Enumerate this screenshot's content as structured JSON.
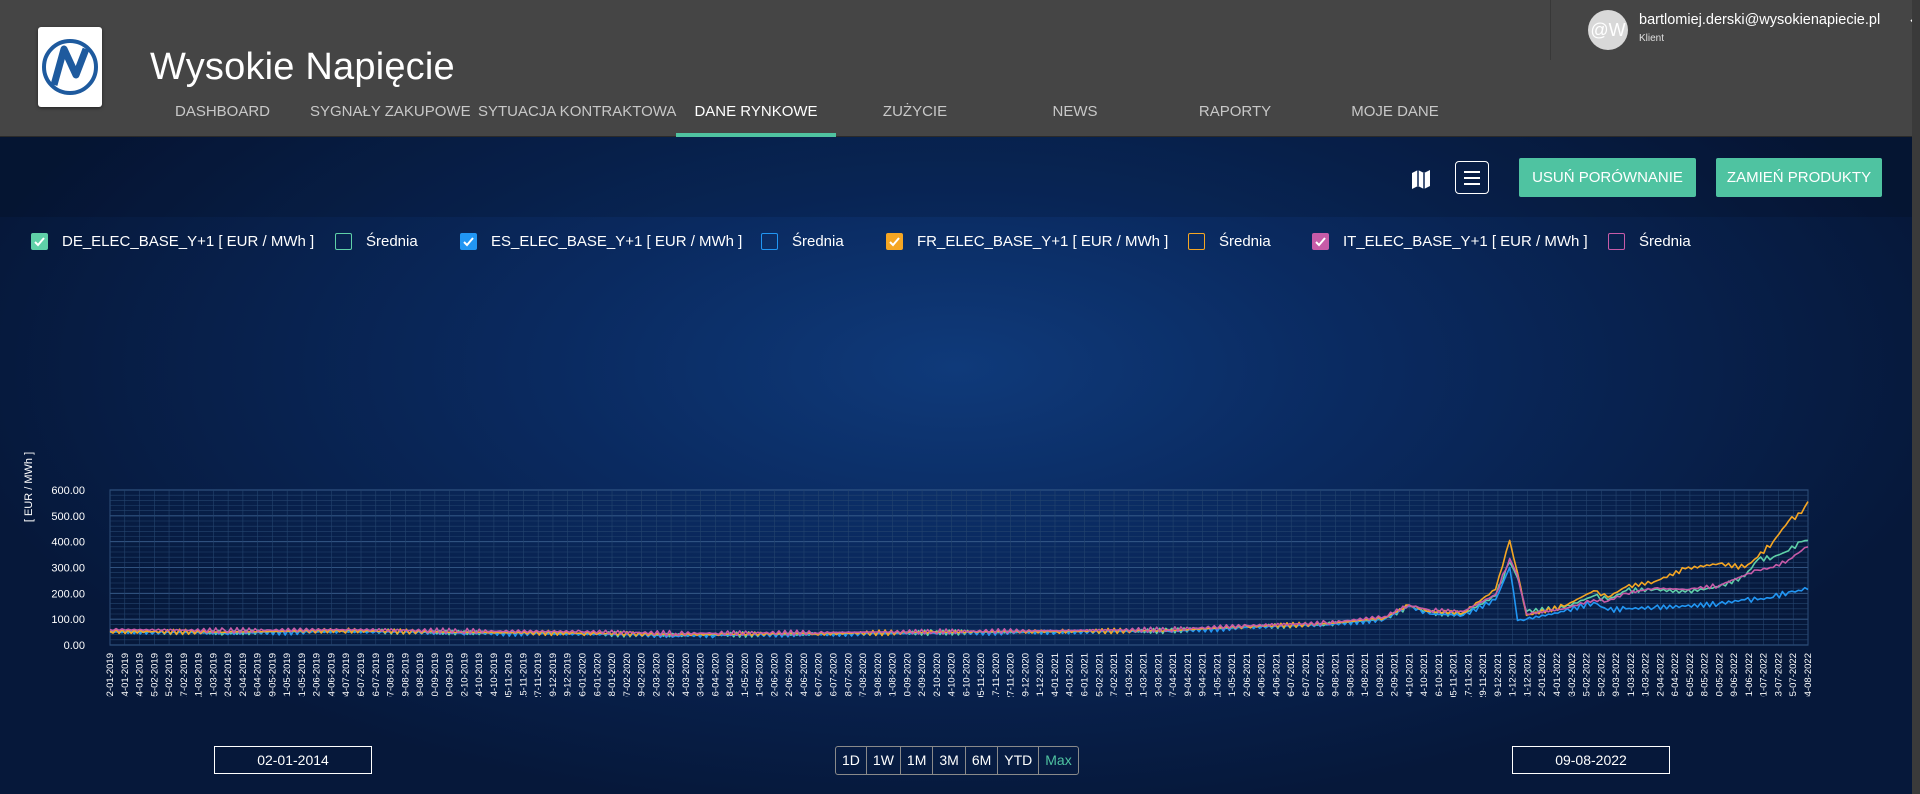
{
  "app": {
    "title": "Wysokie Napięcie"
  },
  "nav": {
    "items": [
      {
        "label": "DASHBOARD",
        "active": false
      },
      {
        "label": "SYGNAŁY ZAKUPOWE",
        "active": false
      },
      {
        "label": "SYTUACJA KONTRAKTOWA",
        "active": false
      },
      {
        "label": "DANE RYNKOWE",
        "active": true
      },
      {
        "label": "ZUŻYCIE",
        "active": false
      },
      {
        "label": "NEWS",
        "active": false
      },
      {
        "label": "RAPORTY",
        "active": false
      },
      {
        "label": "MOJE DANE",
        "active": false
      }
    ]
  },
  "user": {
    "avatar_text": "@W",
    "email": "bartlomiej.derski@wysokienapiecie.pl",
    "role": "Klient"
  },
  "toolbar": {
    "map_icon": "map-icon",
    "menu_icon": "hamburger-menu-icon",
    "remove_compare_label": "USUŃ PORÓWNANIE",
    "swap_products_label": "ZAMIEŃ PRODUKTY"
  },
  "legend": [
    {
      "label": "DE_ELEC_BASE_Y+1 [ EUR / MWh ]",
      "checked": true,
      "color": "#5fd0a8"
    },
    {
      "label": "Średnia",
      "checked": false,
      "color": "#5fd0a8"
    },
    {
      "label": "ES_ELEC_BASE_Y+1 [ EUR / MWh ]",
      "checked": true,
      "color": "#2196f3"
    },
    {
      "label": "Średnia",
      "checked": false,
      "color": "#2196f3"
    },
    {
      "label": "FR_ELEC_BASE_Y+1 [ EUR / MWh ]",
      "checked": true,
      "color": "#f5a623"
    },
    {
      "label": "Średnia",
      "checked": false,
      "color": "#f5a623"
    },
    {
      "label": "IT_ELEC_BASE_Y+1 [ EUR / MWh ]",
      "checked": true,
      "color": "#c75ba8"
    },
    {
      "label": "Średnia",
      "checked": false,
      "color": "#c75ba8"
    }
  ],
  "chart_data": {
    "type": "line",
    "ylabel": "[ EUR / MWh ]",
    "ylim": [
      0,
      600
    ],
    "yticks": [
      "0.00",
      "100.00",
      "200.00",
      "300.00",
      "400.00",
      "500.00",
      "600.00"
    ],
    "grid": true,
    "xticks": [
      "02-01-2019",
      "14-01-2019",
      "24-01-2019",
      "05-02-2019",
      "15-02-2019",
      "27-02-2019",
      "11-03-2019",
      "21-03-2019",
      "02-04-2019",
      "12-04-2019",
      "26-04-2019",
      "09-05-2019",
      "21-05-2019",
      "31-05-2019",
      "12-06-2019",
      "24-06-2019",
      "04-07-2019",
      "16-07-2019",
      "26-07-2019",
      "07-08-2019",
      "19-08-2019",
      "29-08-2019",
      "10-09-2019",
      "20-09-2019",
      "02-10-2019",
      "14-10-2019",
      "24-10-2019",
      "05-11-2019",
      "15-11-2019",
      "27-11-2019",
      "09-12-2019",
      "19-12-2019",
      "06-01-2020",
      "16-01-2020",
      "28-01-2020",
      "07-02-2020",
      "19-02-2020",
      "02-03-2020",
      "12-03-2020",
      "24-03-2020",
      "03-04-2020",
      "16-04-2020",
      "28-04-2020",
      "11-05-2020",
      "21-05-2020",
      "02-06-2020",
      "12-06-2020",
      "24-06-2020",
      "06-07-2020",
      "16-07-2020",
      "28-07-2020",
      "07-08-2020",
      "19-08-2020",
      "31-08-2020",
      "10-09-2020",
      "22-09-2020",
      "02-10-2020",
      "14-10-2020",
      "26-10-2020",
      "05-11-2020",
      "17-11-2020",
      "27-11-2020",
      "09-12-2020",
      "21-12-2020",
      "04-01-2021",
      "14-01-2021",
      "26-01-2021",
      "05-02-2021",
      "17-02-2021",
      "01-03-2021",
      "11-03-2021",
      "23-03-2021",
      "07-04-2021",
      "19-04-2021",
      "29-04-2021",
      "11-05-2021",
      "21-05-2021",
      "02-06-2021",
      "14-06-2021",
      "24-06-2021",
      "06-07-2021",
      "16-07-2021",
      "28-07-2021",
      "09-08-2021",
      "19-08-2021",
      "31-08-2021",
      "10-09-2021",
      "22-09-2021",
      "04-10-2021",
      "14-10-2021",
      "26-10-2021",
      "05-11-2021",
      "17-11-2021",
      "29-11-2021",
      "09-12-2021",
      "21-12-2021",
      "31-12-2021",
      "12-01-2022",
      "24-01-2022",
      "03-02-2022",
      "15-02-2022",
      "25-02-2022",
      "09-03-2022",
      "21-03-2022",
      "31-03-2022",
      "12-04-2022",
      "26-04-2022",
      "06-05-2022",
      "18-05-2022",
      "30-05-2022",
      "09-06-2022",
      "21-06-2022",
      "01-07-2022",
      "13-07-2022",
      "25-07-2022",
      "04-08-2022"
    ],
    "x": [
      "2019-01-02",
      "2019-04-01",
      "2019-07-01",
      "2019-10-01",
      "2020-01-02",
      "2020-03-15",
      "2020-04-15",
      "2020-07-01",
      "2020-10-01",
      "2021-01-04",
      "2021-04-01",
      "2021-06-01",
      "2021-08-01",
      "2021-09-15",
      "2021-10-04",
      "2021-10-20",
      "2021-11-15",
      "2021-12-10",
      "2021-12-21",
      "2021-12-27",
      "2022-01-03",
      "2022-02-01",
      "2022-02-24",
      "2022-03-07",
      "2022-03-21",
      "2022-04-12",
      "2022-05-06",
      "2022-06-01",
      "2022-06-21",
      "2022-07-01",
      "2022-07-13",
      "2022-07-25",
      "2022-08-04",
      "2022-08-09"
    ],
    "series": [
      {
        "name": "DE_ELEC_BASE_Y+1 [ EUR / MWh ]",
        "color": "#5fd0a8",
        "values": [
          52,
          48,
          55,
          48,
          45,
          38,
          40,
          43,
          48,
          52,
          55,
          70,
          80,
          100,
          150,
          125,
          120,
          190,
          320,
          260,
          130,
          145,
          190,
          175,
          210,
          215,
          205,
          225,
          265,
          330,
          340,
          365,
          400,
          405
        ]
      },
      {
        "name": "ES_ELEC_BASE_Y+1 [ EUR / MWh ]",
        "color": "#2196f3",
        "values": [
          50,
          46,
          52,
          46,
          43,
          36,
          38,
          41,
          46,
          50,
          53,
          68,
          78,
          100,
          150,
          120,
          115,
          175,
          300,
          95,
          100,
          130,
          165,
          135,
          140,
          145,
          150,
          160,
          175,
          175,
          185,
          205,
          210,
          215
        ]
      },
      {
        "name": "FR_ELEC_BASE_Y+1 [ EUR / MWh ]",
        "color": "#f5a623",
        "values": [
          53,
          50,
          56,
          49,
          46,
          40,
          42,
          44,
          50,
          53,
          56,
          72,
          82,
          105,
          155,
          130,
          125,
          215,
          405,
          280,
          115,
          150,
          210,
          185,
          225,
          245,
          295,
          315,
          300,
          340,
          400,
          480,
          510,
          555
        ]
      },
      {
        "name": "IT_ELEC_BASE_Y+1 [ EUR / MWh ]",
        "color": "#c75ba8",
        "values": [
          60,
          56,
          60,
          54,
          52,
          45,
          46,
          48,
          52,
          56,
          60,
          75,
          85,
          110,
          155,
          135,
          130,
          195,
          335,
          270,
          120,
          140,
          175,
          170,
          200,
          220,
          215,
          230,
          270,
          290,
          300,
          330,
          365,
          380
        ]
      }
    ]
  },
  "date_range": {
    "start": "02-01-2014",
    "end": "09-08-2022",
    "buttons": [
      "1D",
      "1W",
      "1M",
      "3M",
      "6M",
      "YTD",
      "Max"
    ],
    "active": "Max"
  }
}
